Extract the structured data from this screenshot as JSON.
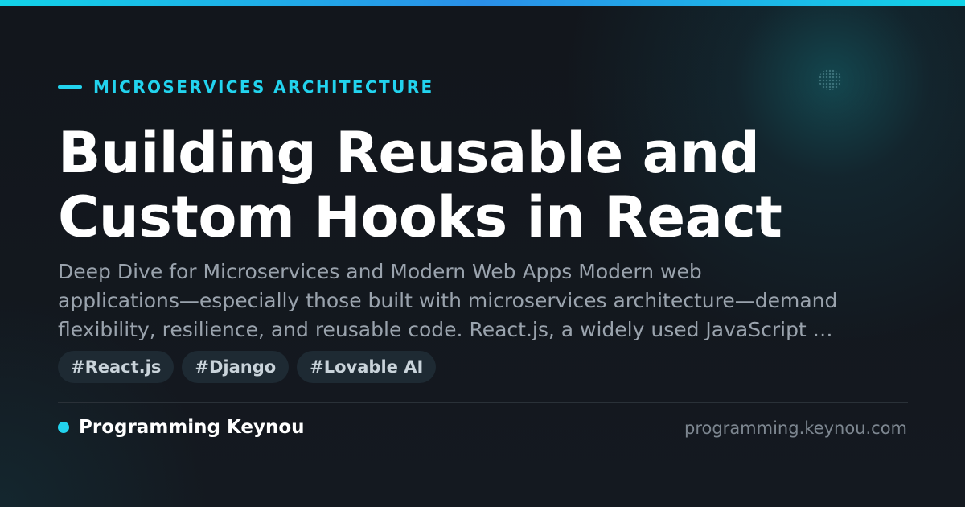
{
  "kicker": "MICROSERVICES ARCHITECTURE",
  "title": {
    "line1": "Building Reusable and",
    "line2": "Custom Hooks in React"
  },
  "description": {
    "line1": "Deep Dive for Microservices and Modern Web Apps Modern web",
    "line2": "applications—especially those built with microservices architecture—demand",
    "line3": "flexibility, resilience, and reusable code. React.js, a widely used JavaScript …"
  },
  "tags": [
    "#React.js",
    "#Django",
    "#Lovable AI"
  ],
  "footer": {
    "brand_name": "Programming Keynou",
    "domain": "programming.keynou.com"
  },
  "colors": {
    "accent": "#22d3ee",
    "background": "#12161c",
    "tag_background": "#1e2a33"
  },
  "icons": {
    "kicker": "accent-line-icon",
    "brand": "brand-dot-icon"
  }
}
